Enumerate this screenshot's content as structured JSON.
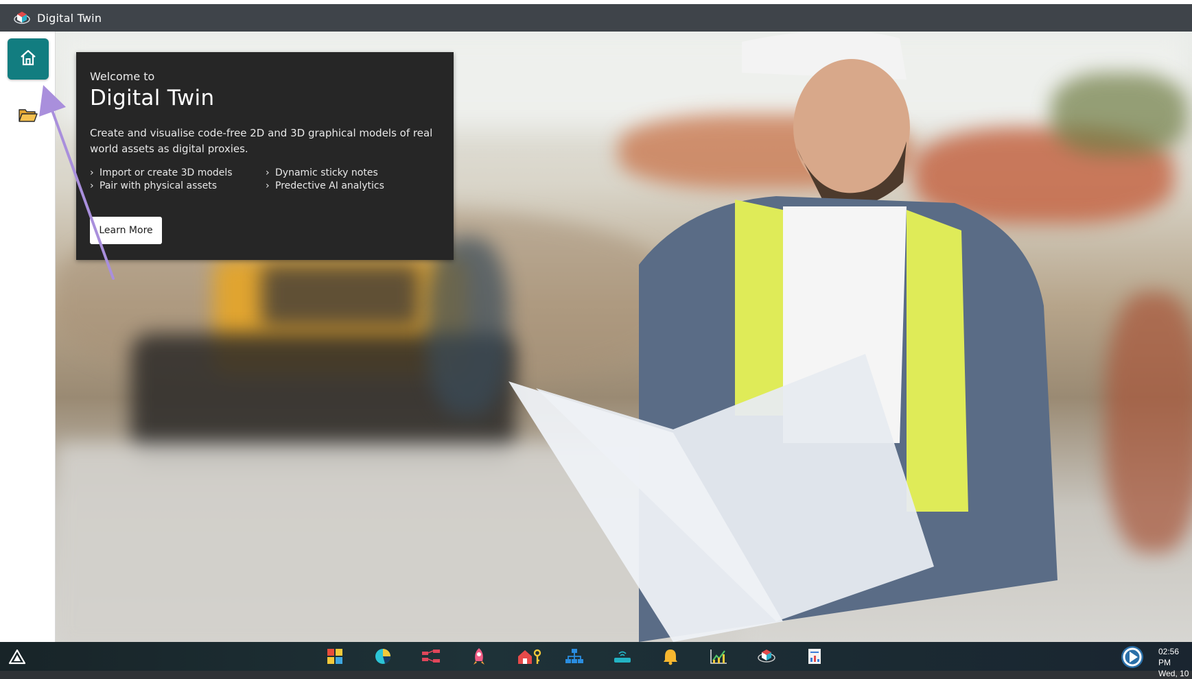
{
  "app": {
    "title": "Digital Twin"
  },
  "welcome": {
    "pre_title": "Welcome to",
    "title": "Digital Twin",
    "description": "Create and visualise code-free 2D and 3D graphical models of real world assets as digital proxies.",
    "features": [
      "Import or create 3D models",
      "Pair with physical assets",
      "Dynamic sticky notes",
      "Predective AI analytics"
    ],
    "learn_more_label": "Learn More"
  },
  "sidebar": {
    "items": [
      {
        "icon": "home-icon",
        "active": true
      },
      {
        "icon": "folder-open-icon",
        "active": false
      }
    ]
  },
  "colors": {
    "titlebar": "#3f444a",
    "accent": "#127d80",
    "card": "#262626",
    "annotation_arrow": "#a98fdc"
  },
  "taskbar": {
    "icons": [
      "grid-apps-icon",
      "pie-chart-icon",
      "flow-icon",
      "rocket-icon",
      "home-key-icon",
      "org-chart-icon",
      "router-icon",
      "bell-icon",
      "line-chart-icon",
      "digital-twin-icon",
      "report-icon"
    ],
    "clock_time": "02:56 PM",
    "clock_date": "Wed, 10"
  }
}
